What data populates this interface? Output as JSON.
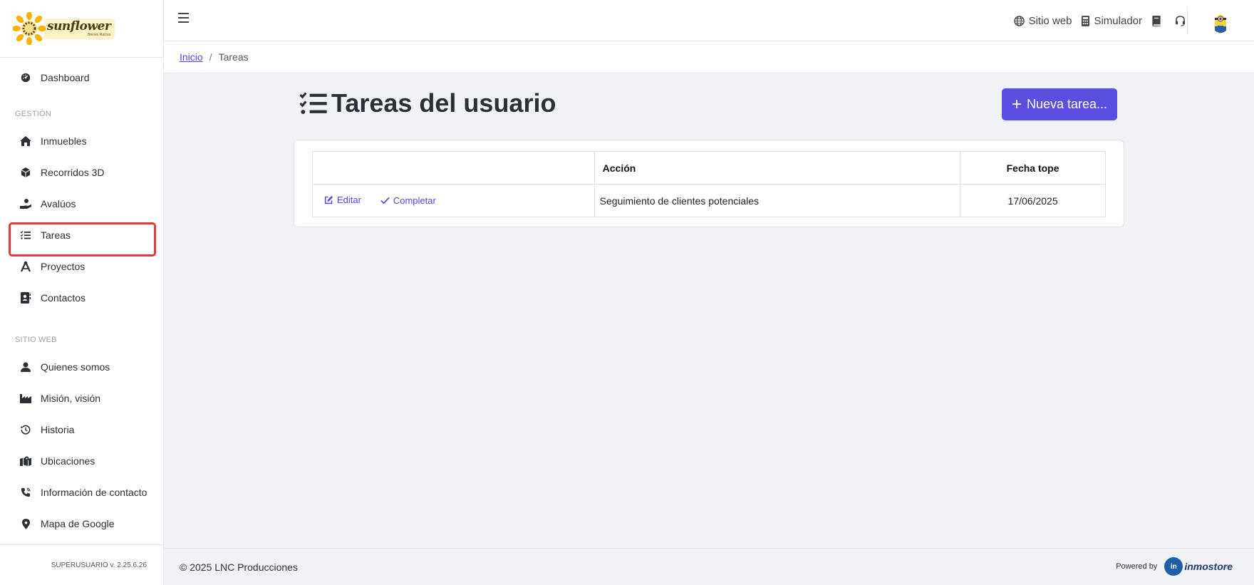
{
  "brand": {
    "name": "sunflower",
    "tagline": "Bienes Raíces"
  },
  "sidebar": {
    "items_top": [
      {
        "label": "Dashboard",
        "icon": "gauge-icon"
      }
    ],
    "section_gestion": "GESTIÓN",
    "items_gestion": [
      {
        "label": "Inmuebles",
        "icon": "home-icon"
      },
      {
        "label": "Recorridos 3D",
        "icon": "cube-icon"
      },
      {
        "label": "Avalúos",
        "icon": "hand-coin-icon"
      },
      {
        "label": "Tareas",
        "icon": "task-list-icon",
        "active": true
      },
      {
        "label": "Proyectos",
        "icon": "compass-icon"
      },
      {
        "label": "Contactos",
        "icon": "address-book-icon"
      }
    ],
    "section_sitio": "SITIO WEB",
    "items_sitio": [
      {
        "label": "Quienes somos",
        "icon": "user-icon"
      },
      {
        "label": "Misión, visión",
        "icon": "industry-icon"
      },
      {
        "label": "Historia",
        "icon": "history-icon"
      },
      {
        "label": "Ubicaciones",
        "icon": "map-location-icon"
      },
      {
        "label": "Información de contacto",
        "icon": "phone-icon"
      },
      {
        "label": "Mapa de Google",
        "icon": "map-pin-icon"
      }
    ],
    "footer": "SUPERUSUARIO v. 2.25.6.26"
  },
  "topbar": {
    "links": [
      {
        "label": "Sitio web",
        "icon": "globe-icon"
      },
      {
        "label": "Simulador",
        "icon": "calculator-icon"
      }
    ],
    "book_icon": "book-icon",
    "support_icon": "headset-icon"
  },
  "breadcrumb": {
    "home": "Inicio",
    "separator": "/",
    "current": "Tareas"
  },
  "main": {
    "title": "Tareas del usuario",
    "new_button": "Nueva tarea...",
    "table": {
      "headers": [
        "",
        "Acción",
        "Fecha tope"
      ],
      "rows": [
        {
          "edit_label": "Editar",
          "complete_label": "Completar",
          "accion": "Seguimiento de clientes potenciales",
          "fecha": "17/06/2025"
        }
      ]
    }
  },
  "footer": {
    "copyright": "© 2025 LNC Producciones",
    "powered_by": "Powered by",
    "powered_brand": "inmostore"
  },
  "colors": {
    "accent": "#5a4fe0",
    "link": "#4f46e5",
    "highlight": "#e03a3a",
    "background": "#f1f2f6"
  }
}
